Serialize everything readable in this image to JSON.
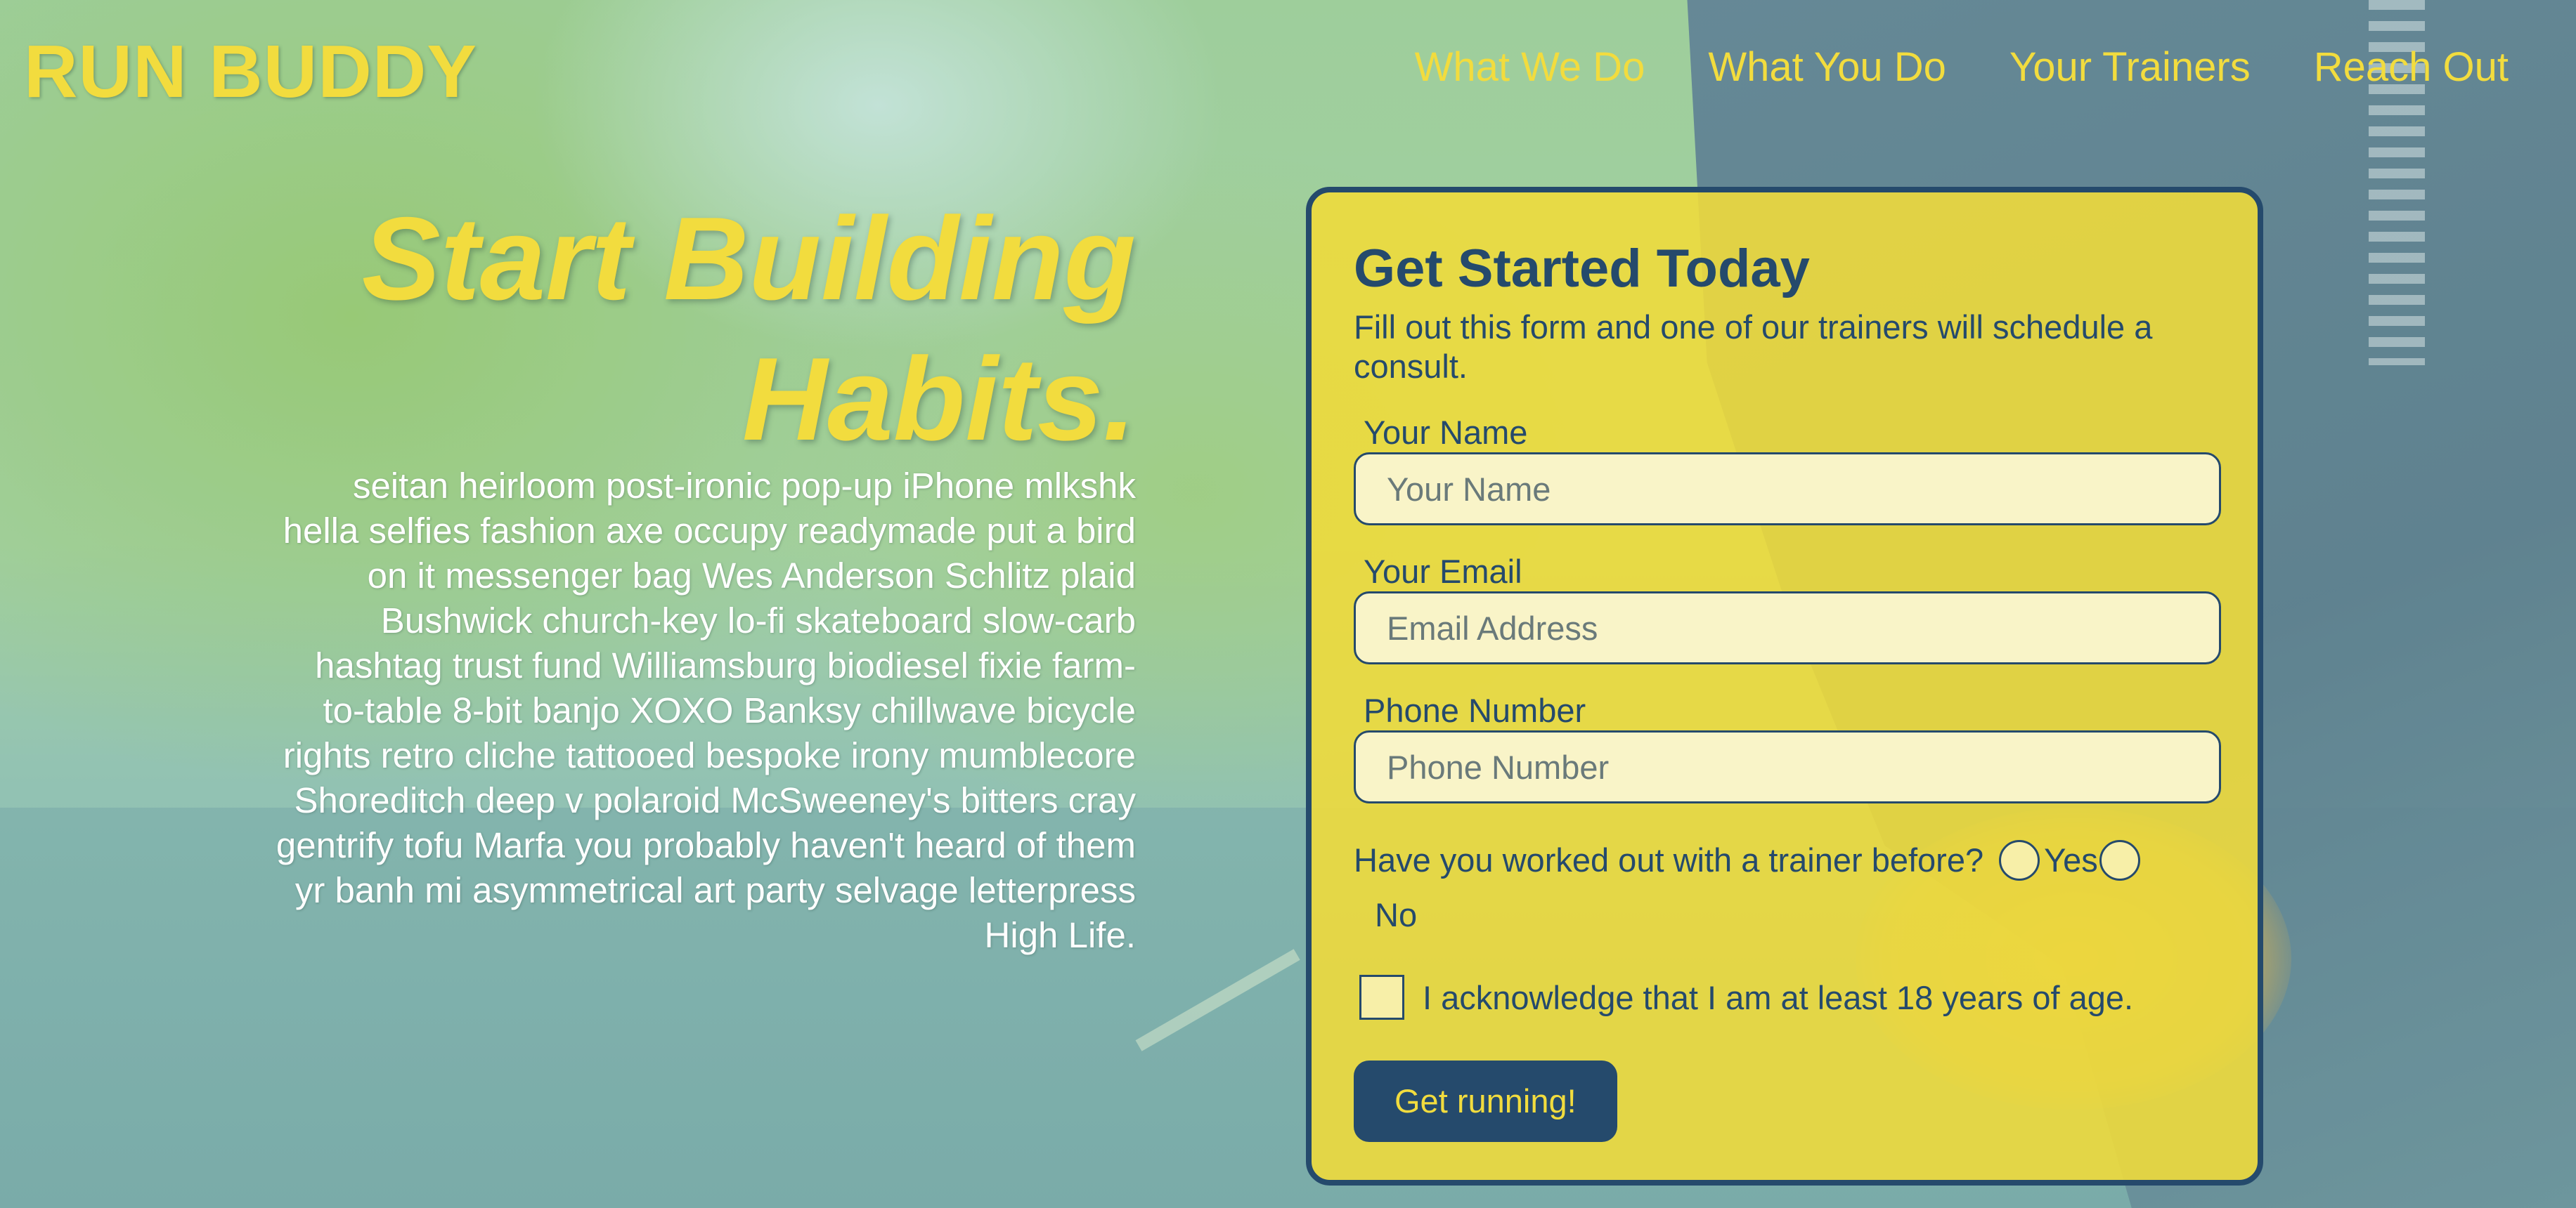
{
  "header": {
    "logo": "RUN BUDDY",
    "nav": [
      {
        "label": "What We Do"
      },
      {
        "label": "What You Do"
      },
      {
        "label": "Your Trainers"
      },
      {
        "label": "Reach Out"
      }
    ]
  },
  "hero": {
    "title": "Start Building Habits.",
    "body": "seitan heirloom post-ironic pop-up iPhone mlkshk hella selfies fashion axe occupy readymade put a bird on it messenger bag Wes Anderson Schlitz plaid Bushwick church-key lo-fi skateboard slow-carb hashtag trust fund Williamsburg biodiesel fixie farm-to-table 8-bit banjo XOXO Banksy chillwave bicycle rights retro cliche tattooed bespoke irony mumblecore Shoreditch deep v polaroid McSweeney's bitters cray gentrify tofu Marfa you probably haven't heard of them yr banh mi asymmetrical art party selvage letterpress High Life."
  },
  "form": {
    "title": "Get Started Today",
    "subtitle": "Fill out this form and one of our trainers will schedule a consult.",
    "fields": [
      {
        "label": "Your Name",
        "placeholder": "Your Name",
        "value": ""
      },
      {
        "label": "Your Email",
        "placeholder": "Email Address",
        "value": ""
      },
      {
        "label": "Phone Number",
        "placeholder": "Phone Number",
        "value": ""
      }
    ],
    "trainer_question": "Have you worked out with a trainer before?",
    "option_yes": "Yes",
    "option_no": "No",
    "acknowledge": "I acknowledge that I am at least 18 years of age.",
    "submit": "Get running!"
  },
  "colors": {
    "accent": "#f2dc3e",
    "navy": "#254a6c",
    "form_bg": "#eeda3c",
    "input_bg": "#f9f4c8"
  }
}
